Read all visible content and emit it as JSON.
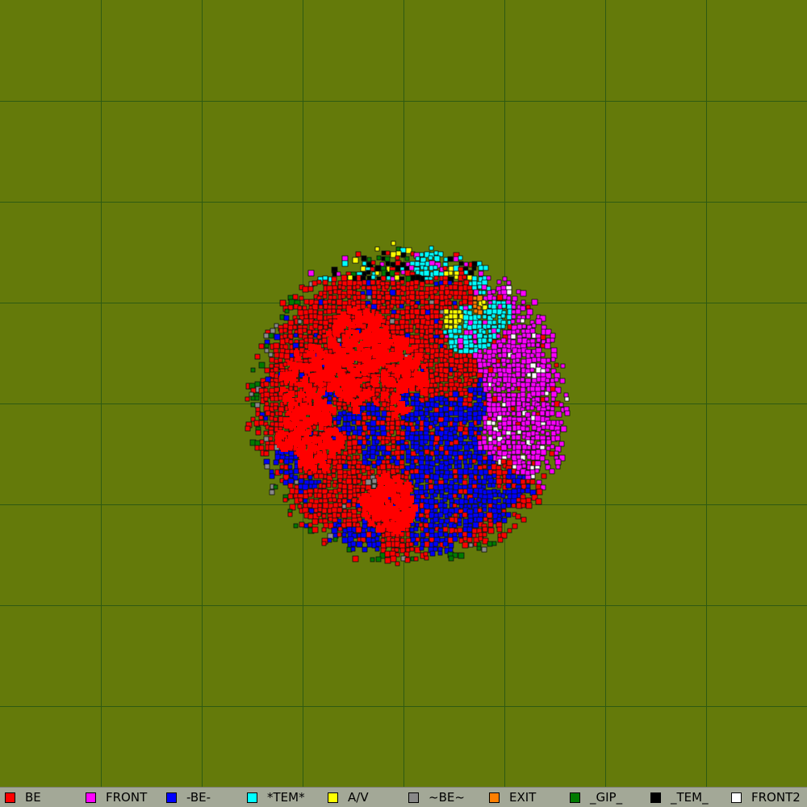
{
  "map": {
    "background_color": "#647a0a",
    "grid_color": "#2e5a12",
    "grid_divisions": 8
  },
  "legend": [
    {
      "label": "BE",
      "color": "#ff0000"
    },
    {
      "label": "FRONT",
      "color": "#ff00ff"
    },
    {
      "label": "-BE-",
      "color": "#0000ff"
    },
    {
      "label": "*TEM*",
      "color": "#00ffff"
    },
    {
      "label": "A/V",
      "color": "#ffff00"
    },
    {
      "label": "~BE~",
      "color": "#888888"
    },
    {
      "label": "EXIT",
      "color": "#ff7f00"
    },
    {
      "label": "_GIP_",
      "color": "#007a00"
    },
    {
      "label": "_TEM_",
      "color": "#000000"
    },
    {
      "label": "FRONT2",
      "color": "#ffffff"
    }
  ]
}
